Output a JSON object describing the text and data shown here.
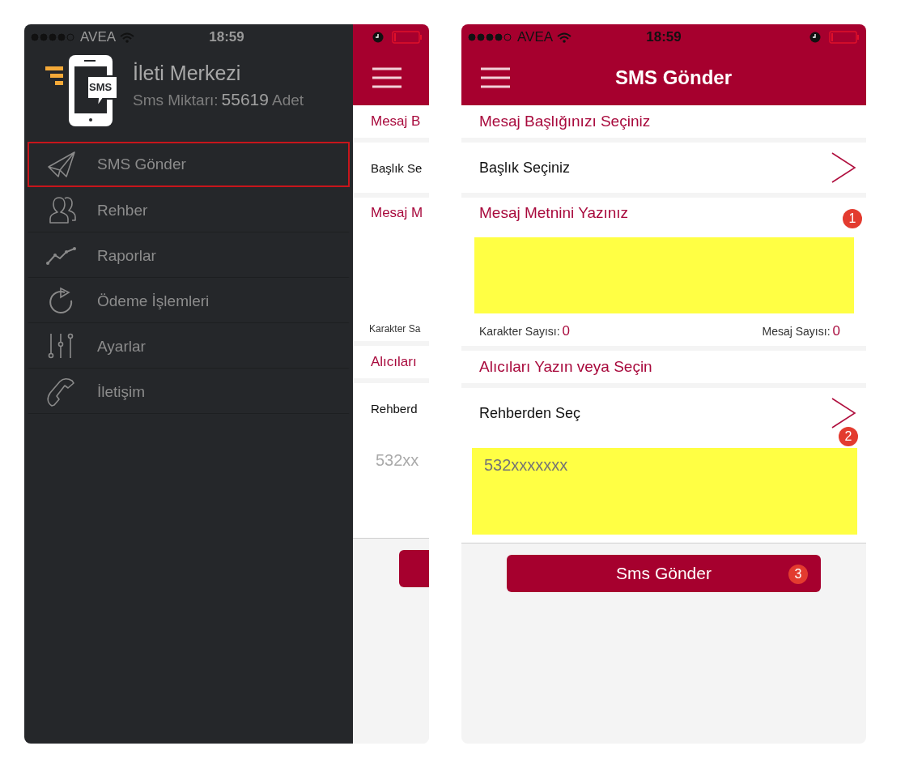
{
  "left_phone": {
    "status_bar": {
      "carrier": "AVEA",
      "time": "18:59"
    },
    "drawer": {
      "logo_text": "SMS",
      "title": "İleti Merkezi",
      "sms_label": "Sms Miktarı:",
      "sms_count": "55619",
      "sms_unit": "Adet",
      "items": [
        {
          "label": "SMS Gönder",
          "selected": true
        },
        {
          "label": "Rehber",
          "selected": false
        },
        {
          "label": "Raporlar",
          "selected": false
        },
        {
          "label": "Ödeme İşlemleri",
          "selected": false
        },
        {
          "label": "Ayarlar",
          "selected": false
        },
        {
          "label": "İletişim",
          "selected": false
        }
      ]
    },
    "peek": {
      "title_section": "Mesaj B",
      "title_row": "Başlık Se",
      "text_section": "Mesaj M",
      "char_count_label": "Karakter Sa",
      "recipients_section": "Alıcıları",
      "contacts_row": "Rehberd",
      "recipients_placeholder": "532xx",
      "highlighted": false
    }
  },
  "right_phone": {
    "status_bar": {
      "carrier": "AVEA",
      "time": "18:59"
    },
    "header": {
      "title": "SMS Gönder"
    },
    "form": {
      "title_section": "Mesaj Başlığınızı Seçiniz",
      "title_row": "Başlık Seçiniz",
      "text_section": "Mesaj Metnini Yazınız",
      "char_count_label": "Karakter Sayısı:",
      "char_count": "0",
      "msg_count_label": "Mesaj Sayısı:",
      "msg_count": "0",
      "recipients_section": "Alıcıları Yazın veya Seçin",
      "contacts_row": "Rehberden Seç",
      "recipients_placeholder": "532xxxxxxx",
      "send_button": "Sms Gönder",
      "highlighted": true
    },
    "annotations": [
      "1",
      "2",
      "3"
    ]
  }
}
